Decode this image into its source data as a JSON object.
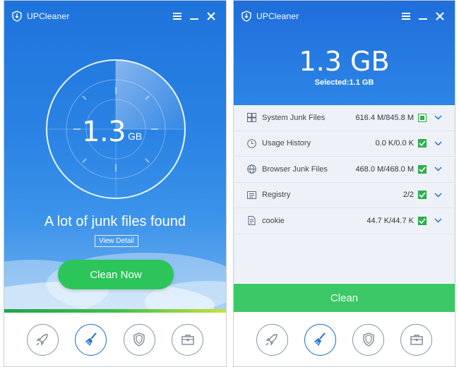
{
  "left": {
    "title": "UPCleaner",
    "scan_value": "1.3",
    "scan_unit": "GB",
    "found_message": "A lot of junk files found",
    "view_detail_label": "View Detail",
    "clean_now_label": "Clean Now"
  },
  "right": {
    "title": "UPCleaner",
    "total_size": "1.3 GB",
    "selected_text": "Selected:1.1 GB",
    "items": [
      {
        "name": "System Junk Files",
        "size": "616.4 M/845.8 M",
        "check_state": "partial",
        "icon": "windows-icon"
      },
      {
        "name": "Usage History",
        "size": "0.0 K/0.0 K",
        "check_state": "checked",
        "icon": "clock-icon"
      },
      {
        "name": "Browser Junk Files",
        "size": "468.0 M/468.0 M",
        "check_state": "checked",
        "icon": "globe-icon"
      },
      {
        "name": "Registry",
        "size": "2/2",
        "check_state": "checked",
        "icon": "registry-icon"
      },
      {
        "name": "cookie",
        "size": "44.7 K/44.7 K",
        "check_state": "checked",
        "icon": "cookie-icon"
      }
    ],
    "clean_label": "Clean"
  },
  "nav": [
    {
      "icon": "rocket-icon",
      "active": false
    },
    {
      "icon": "broom-icon",
      "active": true
    },
    {
      "icon": "shield-icon",
      "active": false
    },
    {
      "icon": "toolbox-icon",
      "active": false
    }
  ],
  "colors": {
    "brand_blue": "#1f6fd4",
    "accent_green": "#2cc55a",
    "check_green": "#2cb34e"
  }
}
